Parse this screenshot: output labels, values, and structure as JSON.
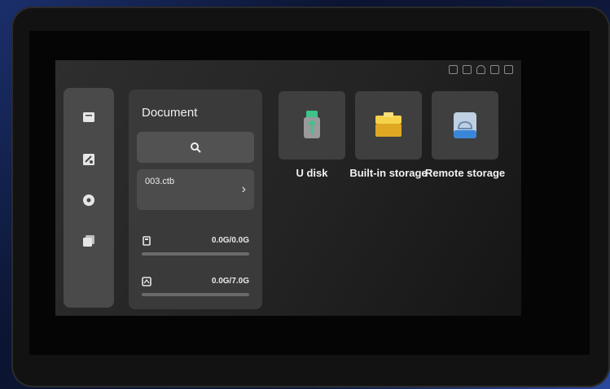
{
  "document_panel": {
    "title": "Document",
    "file": {
      "name": "003.ctb"
    },
    "storage": [
      {
        "icon": "u-disk-icon",
        "value": "0.0G/0.0G",
        "used_fraction": 0.0
      },
      {
        "icon": "internal-storage-icon",
        "value": "0.0G/7.0G",
        "used_fraction": 0.0
      }
    ]
  },
  "sidebar": {
    "items": [
      {
        "icon": "folder-icon"
      },
      {
        "icon": "tools-icon"
      },
      {
        "icon": "settings-icon"
      },
      {
        "icon": "layers-icon"
      }
    ]
  },
  "sources": [
    {
      "label": "U disk",
      "icon": "usb-drive-icon",
      "color": "#3cc48a"
    },
    {
      "label": "Built-in storage",
      "icon": "drive-icon",
      "color": "#f2c230"
    },
    {
      "label": "Remote storage",
      "icon": "cloud-icon",
      "color": "#3a86d8"
    }
  ]
}
